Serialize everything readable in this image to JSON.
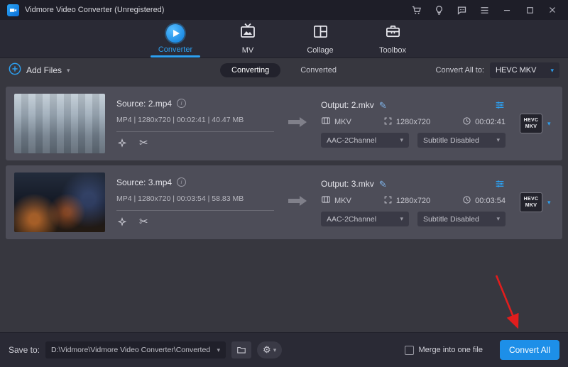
{
  "titlebar": {
    "title": "Vidmore Video Converter (Unregistered)",
    "icons": [
      "app-camcorder-icon",
      "cart-icon",
      "idea-lamp-icon",
      "feedback-icon",
      "menu-icon",
      "minimize-icon",
      "maximize-icon",
      "close-icon"
    ]
  },
  "nav": {
    "tabs": [
      {
        "label": "Converter",
        "icon": "converter-play-icon",
        "active": true
      },
      {
        "label": "MV",
        "icon": "mv-tv-icon",
        "active": false
      },
      {
        "label": "Collage",
        "icon": "collage-grid-icon",
        "active": false
      },
      {
        "label": "Toolbox",
        "icon": "toolbox-icon",
        "active": false
      }
    ]
  },
  "toolbar": {
    "add_files_label": "Add Files",
    "converting_tab": "Converting",
    "converted_tab": "Converted",
    "convert_all_to_label": "Convert All to:",
    "convert_all_to_value": "HEVC MKV"
  },
  "files": [
    {
      "source_label": "Source: 2.mp4",
      "meta": "MP4 | 1280x720 | 00:02:41 | 40.47 MB",
      "output_label": "Output: 2.mkv",
      "format": "MKV",
      "resolution": "1280x720",
      "duration": "00:02:41",
      "audio_option": "AAC-2Channel",
      "subtitle_option": "Subtitle Disabled",
      "profile_badge": "HEVC MKV"
    },
    {
      "source_label": "Source: 3.mp4",
      "meta": "MP4 | 1280x720 | 00:03:54 | 58.83 MB",
      "output_label": "Output: 3.mkv",
      "format": "MKV",
      "resolution": "1280x720",
      "duration": "00:03:54",
      "audio_option": "AAC-2Channel",
      "subtitle_option": "Subtitle Disabled",
      "profile_badge": "HEVC MKV"
    }
  ],
  "bottom_bar": {
    "save_to_label": "Save to:",
    "save_path": "D:\\Vidmore\\Vidmore Video Converter\\Converted",
    "merge_checkbox_label": "Merge into one file",
    "convert_all_button": "Convert All"
  },
  "colors": {
    "accent_blue": "#1d8fe8",
    "titlebar_bg": "#1e1e28",
    "row_bg": "#4d4d58",
    "annotation_red": "#e11d1d"
  }
}
